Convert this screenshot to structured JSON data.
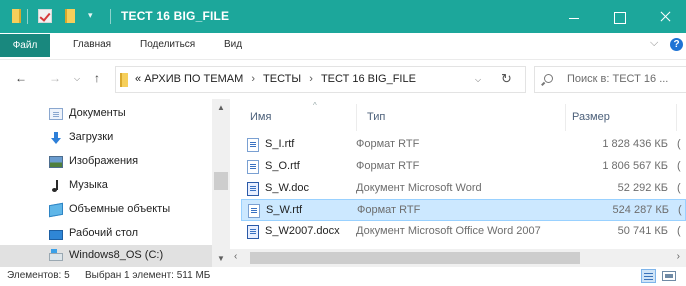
{
  "window": {
    "title": "ТЕСТ 16 BIG_FILE",
    "quick_access_arrow": "▾",
    "controls": {
      "minimize": "minimize",
      "maximize": "maximize",
      "close": "close"
    }
  },
  "ribbon": {
    "tabs": [
      {
        "label": "Файл"
      },
      {
        "label": "Главная"
      },
      {
        "label": "Поделиться"
      },
      {
        "label": "Вид"
      }
    ],
    "help": "?",
    "collapse": "⌵"
  },
  "address": {
    "back": "←",
    "forward": "→",
    "recent": "⌵",
    "up": "↑",
    "overflow": "«",
    "path": [
      "АРХИВ ПО ТЕМАМ",
      "ТЕСТЫ",
      "ТЕСТ 16 BIG_FILE"
    ],
    "separator": "›",
    "dropdown": "⌵",
    "refresh": "↻",
    "search_placeholder": "Поиск в: ТЕСТ 16 ..."
  },
  "nav_pane": {
    "items": [
      {
        "label": "Документы",
        "icon": "documents-icon"
      },
      {
        "label": "Загрузки",
        "icon": "downloads-icon"
      },
      {
        "label": "Изображения",
        "icon": "pictures-icon"
      },
      {
        "label": "Музыка",
        "icon": "music-icon"
      },
      {
        "label": "Объемные объекты",
        "icon": "3d-objects-icon"
      },
      {
        "label": "Рабочий стол",
        "icon": "desktop-icon"
      },
      {
        "label": "Windows8_OS (C:)",
        "icon": "drive-icon",
        "selected": true
      }
    ],
    "scroll_up": "▲",
    "scroll_down": "▼"
  },
  "file_list": {
    "columns": {
      "name": "Имя",
      "type": "Тип",
      "size": "Размер"
    },
    "sort_indicator": "^",
    "rows": [
      {
        "name": "S_I.rtf",
        "type": "Формат RTF",
        "size": "1 828 436 КБ",
        "clip": "(",
        "icon": "rtf-file-icon"
      },
      {
        "name": "S_O.rtf",
        "type": "Формат RTF",
        "size": "1 806 567 КБ",
        "clip": "(",
        "icon": "rtf-file-icon"
      },
      {
        "name": "S_W.doc",
        "type": "Документ Microsoft Word",
        "size": "52 292 КБ",
        "clip": "(",
        "icon": "word-file-icon"
      },
      {
        "name": "S_W.rtf",
        "type": "Формат RTF",
        "size": "524 287 КБ",
        "clip": "(",
        "icon": "rtf-file-icon",
        "selected": true
      },
      {
        "name": "S_W2007.docx",
        "type": "Документ Microsoft Office Word 2007",
        "size": "50 741 КБ",
        "clip": "(",
        "icon": "word-file-icon"
      }
    ],
    "scroll_left": "‹",
    "scroll_right": "›"
  },
  "status": {
    "count": "Элементов: 5",
    "selection": "Выбран 1 элемент: 511 МБ"
  },
  "colors": {
    "titlebar": "#1ca79b",
    "file_tab": "#19887e",
    "selected_row": "#cce8ff",
    "selected_nav": "#e1e1e1"
  }
}
